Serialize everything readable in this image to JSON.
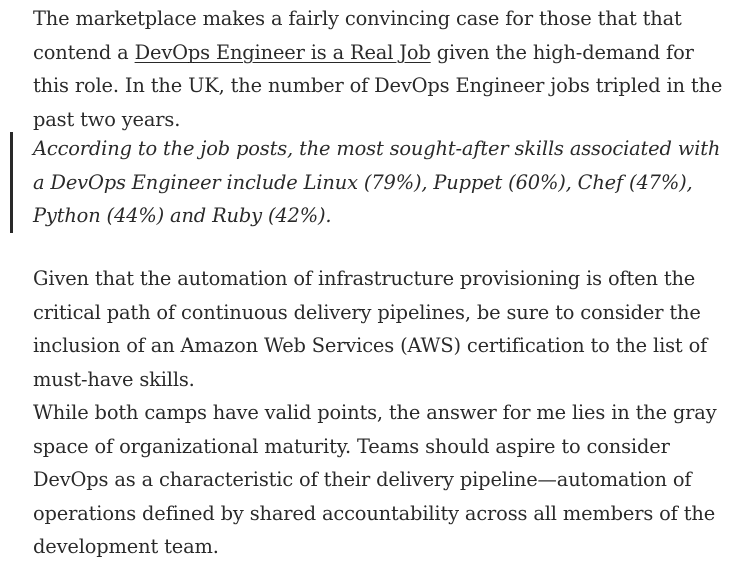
{
  "article": {
    "paragraph_1": {
      "before_link": "The marketplace makes a fairly convincing case for those that that contend a ",
      "link_text": "DevOps Engineer is a Real Job",
      "after_link": " given the high-demand for this role. In the UK, the number of DevOps Engineer jobs tripled in the past two years."
    },
    "blockquote": "According to the job posts, the most sought-after skills associated with a DevOps Engineer include Linux (79%), Puppet (60%), Chef (47%), Python (44%) and Ruby (42%).",
    "paragraph_3": "Given that the automation of infrastructure provisioning is often the critical path of continuous delivery pipelines, be sure to consider the inclusion of an Amazon Web Services (AWS) certification to the list of must-have skills.",
    "paragraph_4": "While both camps have valid points, the answer for me lies in the gray space of organizational maturity. Teams should aspire to consider DevOps as a characteristic of their delivery pipeline—automation of operations defined by shared accountability across all members of the development team."
  }
}
